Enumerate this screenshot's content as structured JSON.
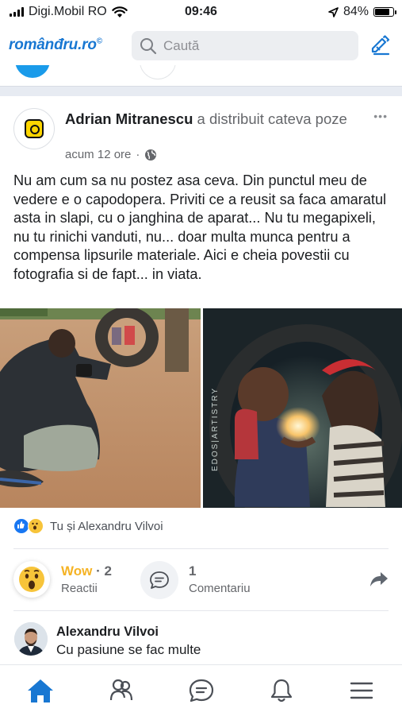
{
  "status_bar": {
    "carrier": "Digi.Mobil RO",
    "time": "09:46",
    "battery_percent": "84%",
    "battery_level": 0.84,
    "icons": [
      "signal-icon",
      "wifi-icon",
      "location-arrow-icon",
      "battery-icon"
    ]
  },
  "header": {
    "logo": "românđru.ro",
    "logo_mark": "©",
    "search_placeholder": "Caută",
    "icons": [
      "search-icon",
      "edit-icon"
    ]
  },
  "post": {
    "author": "Adrian Mitranescu",
    "action": "a distribuit cateva poze",
    "time": "acum 12 ore",
    "separator": "·",
    "more": "•••",
    "text": "Nu am cum sa nu postez asa ceva. Din punctul meu de vedere e o capodopera. Priviti ce a reusit sa faca amaratul asta in slapi, cu o janghina de aparat... Nu tu megapixeli, nu tu rinichi vanduti, nu... doar multa munca pentru a compensa lipsurile materiale. Aici e cheia povestii cu fotografia si de fapt... in viata.",
    "photo_watermark": "EDOS|ARTISTRY",
    "reactions_summary": "Tu și Alexandru Vilvoi",
    "reaction_type": "Wow",
    "reaction_dot": "·",
    "reaction_count": "2",
    "reaction_sub": "Reactii",
    "comment_count": "1",
    "comment_sub": "Comentariu"
  },
  "comment": {
    "author": "Alexandru Vilvoi",
    "text": "Cu pasiune se fac multe"
  },
  "tab_bar": {
    "tabs": [
      "home-icon",
      "groups-icon",
      "messages-icon",
      "notifications-icon",
      "menu-icon"
    ],
    "active": "home-icon",
    "accent": "#1877d2"
  },
  "colors": {
    "brand": "#1877d2",
    "wow": "#f5b325",
    "muted": "#65676b"
  }
}
